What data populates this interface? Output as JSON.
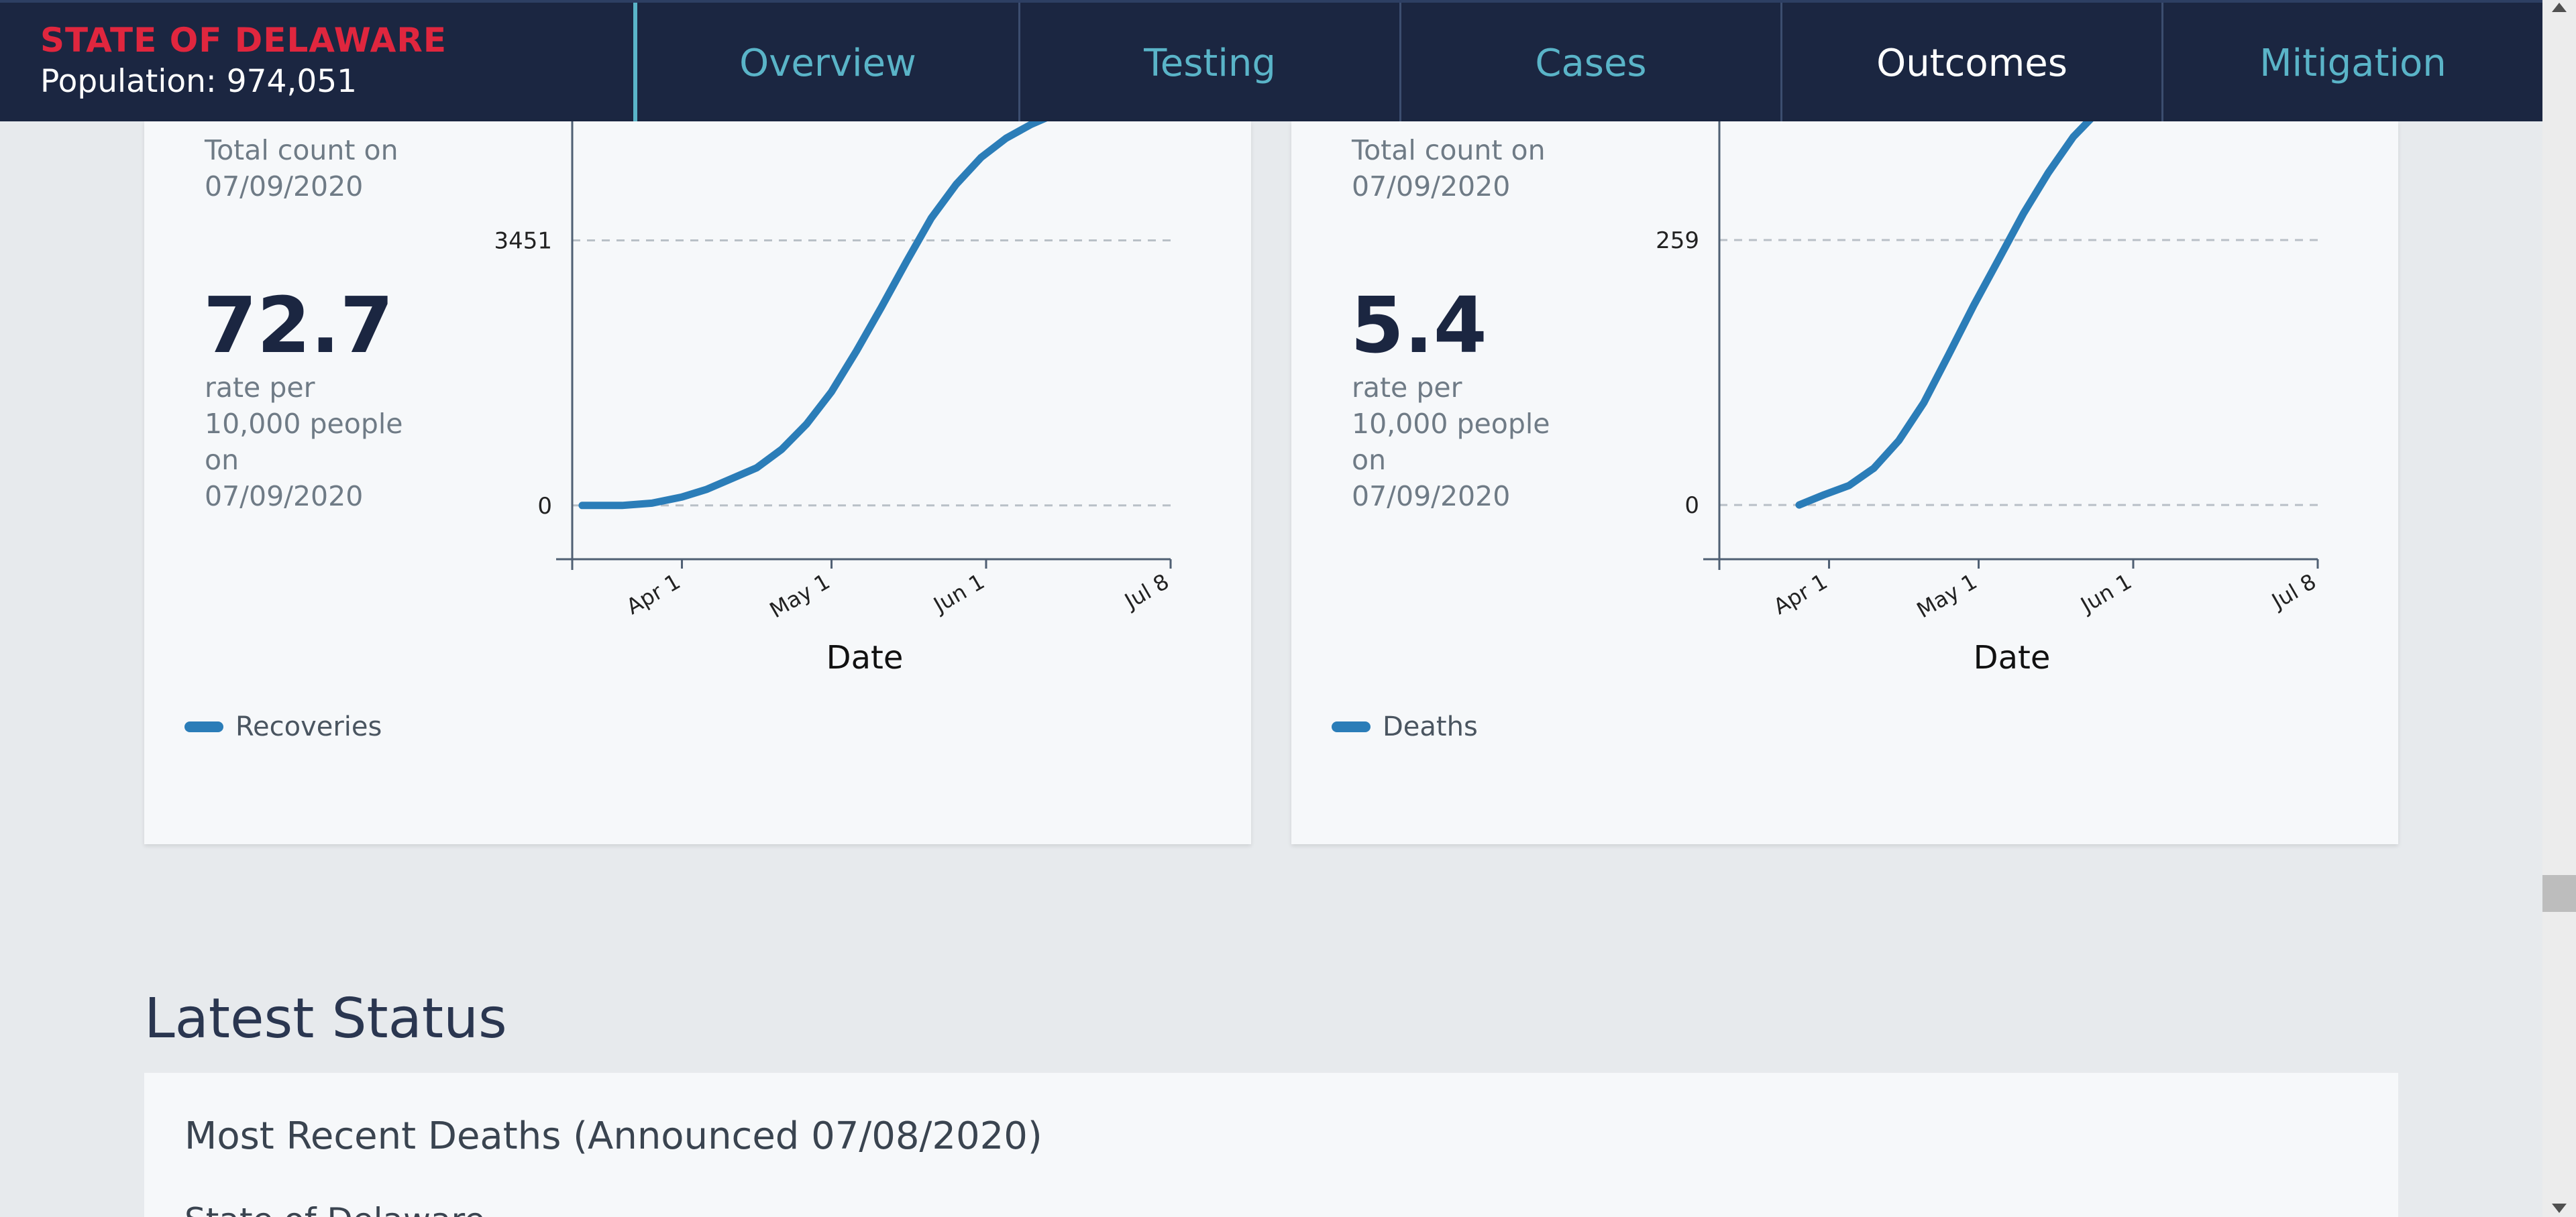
{
  "header": {
    "state_name": "STATE OF DELAWARE",
    "population": "Population: 974,051",
    "tabs": [
      {
        "label": "Overview",
        "active": false
      },
      {
        "label": "Testing",
        "active": false
      },
      {
        "label": "Cases",
        "active": false
      },
      {
        "label": "Outcomes",
        "active": true
      },
      {
        "label": "Mitigation",
        "active": false
      }
    ]
  },
  "colors": {
    "header_bg": "#1b2641",
    "brand_red": "#e0263e",
    "tab_accent": "#5ab4c8",
    "line": "#2b7db8"
  },
  "recoveries_card": {
    "total_label": "Total count on 07/09/2020",
    "rate_value": "72.7",
    "rate_label": "rate per 10,000 people on 07/09/2020",
    "legend": "Recoveries"
  },
  "deaths_card": {
    "total_label": "Total count on 07/09/2020",
    "rate_value": "5.4",
    "rate_label": "rate per 10,000 people on 07/09/2020",
    "legend": "Deaths"
  },
  "chart_data": [
    {
      "type": "line",
      "title": "",
      "xlabel": "Date",
      "ylabel": "",
      "x_ticks": [
        "Apr 1",
        "May 1",
        "Jun 1",
        "Jul 8"
      ],
      "y_ticks": [
        0,
        3451
      ],
      "xlim": [
        "2020-03-10",
        "2020-07-08"
      ],
      "ylim": [
        -700,
        5000
      ],
      "grid": true,
      "legend": "bottom-left",
      "series": [
        {
          "name": "Recoveries",
          "x": [
            "2020-03-12",
            "2020-03-20",
            "2020-03-26",
            "2020-04-01",
            "2020-04-06",
            "2020-04-11",
            "2020-04-16",
            "2020-04-21",
            "2020-04-26",
            "2020-05-01",
            "2020-05-06",
            "2020-05-11",
            "2020-05-16",
            "2020-05-21",
            "2020-05-26",
            "2020-05-31",
            "2020-06-05",
            "2020-06-10",
            "2020-06-15",
            "2020-06-20"
          ],
          "values": [
            0,
            0,
            30,
            110,
            210,
            350,
            490,
            730,
            1060,
            1480,
            2010,
            2580,
            3170,
            3740,
            4180,
            4530,
            4780,
            4960,
            5100,
            5210
          ]
        }
      ]
    },
    {
      "type": "line",
      "title": "",
      "xlabel": "Date",
      "ylabel": "",
      "x_ticks": [
        "Apr 1",
        "May 1",
        "Jun 1",
        "Jul 8"
      ],
      "y_ticks": [
        0,
        259
      ],
      "xlim": [
        "2020-03-10",
        "2020-07-08"
      ],
      "ylim": [
        -53,
        375
      ],
      "grid": true,
      "legend": "bottom-left",
      "series": [
        {
          "name": "Deaths",
          "x": [
            "2020-03-26",
            "2020-03-31",
            "2020-04-05",
            "2020-04-10",
            "2020-04-15",
            "2020-04-20",
            "2020-04-25",
            "2020-04-30",
            "2020-05-05",
            "2020-05-10",
            "2020-05-15",
            "2020-05-20",
            "2020-05-25",
            "2020-05-30",
            "2020-06-04"
          ],
          "values": [
            0,
            10,
            19,
            36,
            63,
            100,
            147,
            195,
            240,
            285,
            325,
            360,
            385,
            400,
            415
          ]
        }
      ]
    }
  ],
  "latest_status": {
    "title": "Latest Status",
    "heading": "Most Recent Deaths (Announced 07/08/2020)",
    "sub": "State of Delaware"
  }
}
